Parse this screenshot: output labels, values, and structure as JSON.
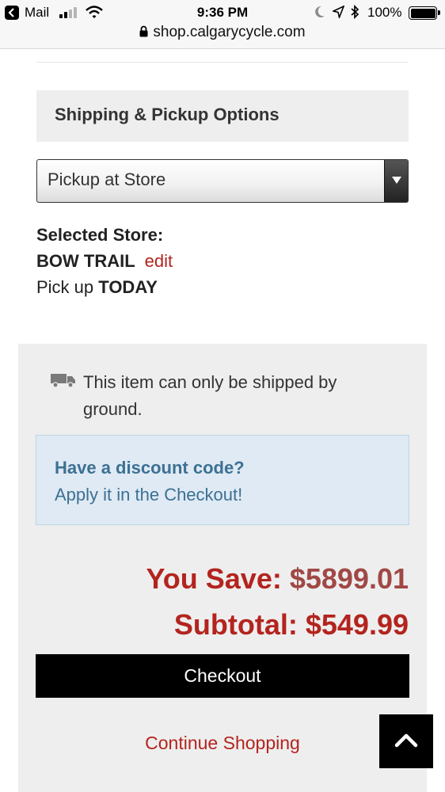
{
  "status_bar": {
    "back_app": "Mail",
    "time": "9:36 PM",
    "battery": "100%"
  },
  "browser": {
    "url": "shop.calgarycycle.com"
  },
  "shipping": {
    "heading": "Shipping & Pickup Options",
    "selected_option": "Pickup at Store"
  },
  "store": {
    "label": "Selected Store:",
    "name": "BOW TRAIL",
    "edit_label": "edit",
    "pickup_prefix": "Pick up",
    "pickup_when": "TODAY"
  },
  "cart": {
    "shipping_note": "This item can only be shipped by ground.",
    "discount_title": "Have a discount code?",
    "discount_text": "Apply it in the Checkout!",
    "save_label": "You Save:",
    "save_amount": "$5899.01",
    "subtotal_label": "Subtotal:",
    "subtotal_amount": "$549.99",
    "checkout_label": "Checkout",
    "continue_label": "Continue Shopping"
  },
  "icons": {
    "back": "back-arrow-icon",
    "signal": "cell-signal-icon",
    "wifi": "wifi-icon",
    "moon": "do-not-disturb-icon",
    "location": "location-arrow-icon",
    "bluetooth": "bluetooth-icon",
    "battery": "battery-icon",
    "lock": "lock-icon",
    "truck": "truck-icon",
    "dropdown": "dropdown-arrow-icon",
    "scroll_top": "chevron-up-icon"
  },
  "colors": {
    "accent_red": "#b3241e",
    "discount_blue": "#3d7093",
    "panel_grey": "#eeeeee"
  }
}
